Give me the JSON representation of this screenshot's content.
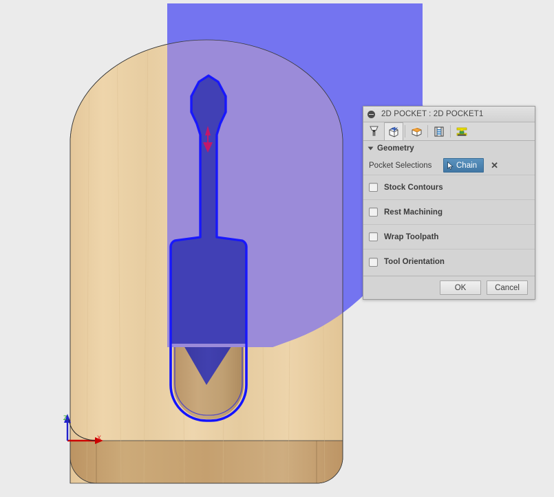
{
  "app": {
    "background_color": "#ebebeb",
    "viewport_name": "cam-3d-viewport"
  },
  "viewport": {
    "model": {
      "material": "wood",
      "wood_color": "#eacfa4",
      "wood_shadow_color": "#c7a373",
      "outline_color": "#3a3a3a",
      "description": "Rounded-top wooden block with screwdriver-shaped pocket"
    },
    "selection_overlay": {
      "color": "#7474f0",
      "blend_over_wood_color": "#9b8bd9",
      "label": "machining-boundary-overlay"
    },
    "pocket": {
      "fill_color": "#3a3aa8",
      "edge_color": "#1414ff",
      "shape": "screwdriver",
      "label": "selected-pocket-geometry"
    },
    "direction_arrow": {
      "color": "#c2186b",
      "label": "toolpath-direction-arrow"
    },
    "origin_marker": {
      "x_axis_color": "#cc0000",
      "y_axis_color": "#00aa00",
      "z_axis_color": "#2222cc",
      "x_label": "X",
      "z_label": "Z"
    }
  },
  "dialog": {
    "title": "2D POCKET : 2D POCKET1",
    "collapse_icon": "minus-circle-icon",
    "tabs": [
      {
        "id": "tool",
        "icon": "endmill-tool-icon",
        "selected": false
      },
      {
        "id": "geometry",
        "icon": "geometry-box-icon",
        "selected": true
      },
      {
        "id": "heights",
        "icon": "heights-box-icon",
        "selected": false
      },
      {
        "id": "passes",
        "icon": "passes-icon",
        "selected": false
      },
      {
        "id": "linking",
        "icon": "linking-icon",
        "selected": false
      }
    ],
    "section": {
      "label": "Geometry",
      "expanded": true
    },
    "pocket_selections": {
      "label": "Pocket Selections",
      "button_label": "Chain",
      "button_icon": "cursor-arrow-icon",
      "clear_icon": "close-x-icon",
      "button_color": "#4a87b8"
    },
    "options": [
      {
        "label": "Stock Contours",
        "checked": false
      },
      {
        "label": "Rest Machining",
        "checked": false
      },
      {
        "label": "Wrap Toolpath",
        "checked": false
      },
      {
        "label": "Tool Orientation",
        "checked": false
      }
    ],
    "footer": {
      "ok_label": "OK",
      "cancel_label": "Cancel"
    }
  }
}
